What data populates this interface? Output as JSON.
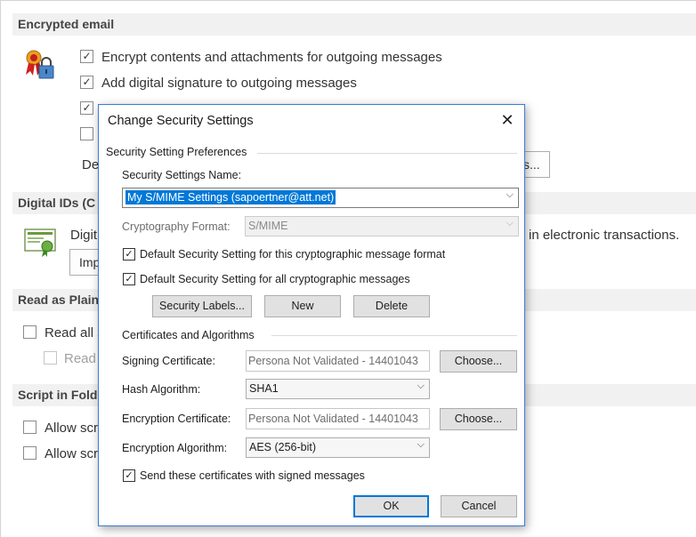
{
  "background": {
    "sections": {
      "encrypted_email": "Encrypted email",
      "digital_ids": "Digital IDs (C",
      "read_as_plain": "Read as Plain",
      "script_in_folders": "Script in Fold"
    },
    "encrypted": {
      "encrypt_label": "Encrypt contents and attachments for outgoing messages",
      "signature_label": "Add digital signature to outgoing messages",
      "de_fragment": "De",
      "settings_button_fragment": "s..."
    },
    "digital_ids": {
      "text_start": "Digit",
      "text_end": "in electronic transactions.",
      "import_fragment": "Imp"
    },
    "read_plain": {
      "read_all_label": "Read all s",
      "read_label": "Read"
    },
    "script": {
      "allow1_label": "Allow scr",
      "allow2_label": "Allow scr"
    }
  },
  "dialog": {
    "title": "Change Security Settings",
    "close_glyph": "✕",
    "preferences_group": "Security Setting Preferences",
    "name_label": "Security Settings Name:",
    "name_value": "My S/MIME Settings (sapoertner@att.net)",
    "crypto_format_label": "Cryptography Format:",
    "crypto_format_value": "S/MIME",
    "default_format_label": "Default Security Setting for this cryptographic message format",
    "default_all_label": "Default Security Setting for all cryptographic messages",
    "security_labels_button": "Security Labels...",
    "new_button": "New",
    "delete_button": "Delete",
    "certs_group": "Certificates and Algorithms",
    "signing_cert_label": "Signing Certificate:",
    "signing_cert_value": "Persona Not Validated - 14401043",
    "choose_label": "Choose...",
    "hash_label": "Hash Algorithm:",
    "hash_value": "SHA1",
    "enc_cert_label": "Encryption Certificate:",
    "enc_cert_value": "Persona Not Validated - 14401043",
    "enc_alg_label": "Encryption Algorithm:",
    "enc_alg_value": "AES (256-bit)",
    "send_certs_label": "Send these certificates with signed messages",
    "ok_button": "OK",
    "cancel_button": "Cancel"
  },
  "glyphs": {
    "check": "✓",
    "dropdown": "⌵"
  },
  "colors": {
    "accent": "#0078d7",
    "dialog_border": "#3a7dd6",
    "section_band": "#f1f1f1"
  }
}
